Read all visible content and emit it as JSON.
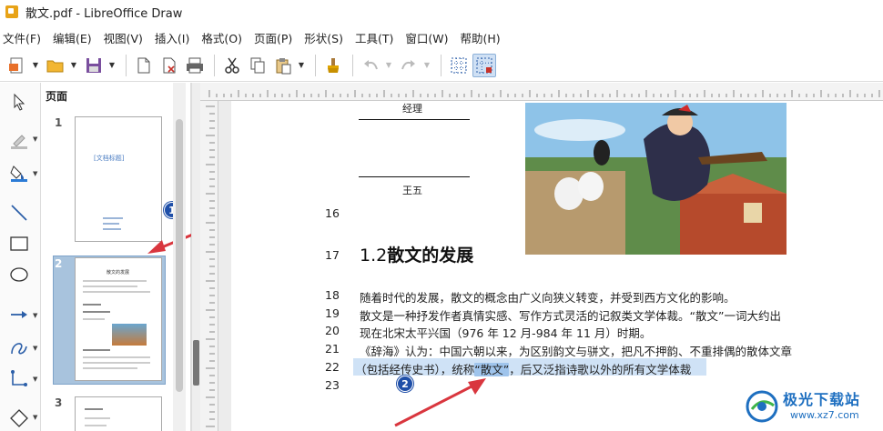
{
  "window": {
    "title": "散文.pdf - LibreOffice Draw"
  },
  "menu": [
    "文件(F)",
    "编辑(E)",
    "视图(V)",
    "插入(I)",
    "格式(O)",
    "页面(P)",
    "形状(S)",
    "工具(T)",
    "窗口(W)",
    "帮助(H)"
  ],
  "toolbar": {
    "icons": [
      "new-document-icon",
      "open-folder-icon",
      "save-icon",
      "export-icon",
      "export-pdf-icon",
      "print-icon",
      "cut-icon",
      "copy-icon",
      "paste-icon",
      "clone-formatting-icon",
      "undo-icon",
      "redo-icon",
      "grid-icon",
      "snap-guides-icon"
    ]
  },
  "leftbar": {
    "icons": [
      "select-arrow-icon",
      "line-color-icon",
      "fill-color-icon",
      "line-icon",
      "rectangle-icon",
      "ellipse-icon",
      "arrow-line-icon",
      "curve-icon",
      "connector-icon",
      "diamond-shape-icon"
    ]
  },
  "pages_panel": {
    "title": "页面",
    "close": "×",
    "pages": [
      {
        "number": "1",
        "title": "[文档标题]"
      },
      {
        "number": "2",
        "title": "散文的发展"
      },
      {
        "number": "3",
        "title": ""
      }
    ]
  },
  "document": {
    "top_label_1": "经理",
    "top_label_2": "王五",
    "lines": [
      {
        "num": "16",
        "text": ""
      },
      {
        "num": "17",
        "text": ""
      },
      {
        "num": "18",
        "text": "随着时代的发展，散文的概念由广义向狭义转变，并受到西方文化的影响。"
      },
      {
        "num": "19",
        "text": "散文是一种抒发作者真情实感、写作方式灵活的记叙类文学体裁。“散文”一词大约出"
      },
      {
        "num": "20",
        "text": "现在北宋太平兴国（976 年 12 月-984 年 11 月）时期。"
      },
      {
        "num": "21",
        "text": "《辞海》认为：中国六朝以来，为区别韵文与骈文，把凡不押韵、不重排偶的散体文章"
      },
      {
        "num": "22",
        "text_before": "（包括经传史书），统称",
        "text_selected": "“散文”",
        "text_after": "，后又泛指诗歌以外的所有文学体裁"
      },
      {
        "num": "23",
        "text": ""
      }
    ],
    "heading_number": "1.2",
    "heading_text": "散文的发展"
  },
  "annotations": {
    "badge_1": "1",
    "badge_2": "2"
  },
  "watermark": {
    "title": "极光下载站",
    "url": "www.xz7.com"
  },
  "colors": {
    "accent": "#1f4fa8",
    "arrow": "#d9363e",
    "selection": "#cfe2f6"
  }
}
